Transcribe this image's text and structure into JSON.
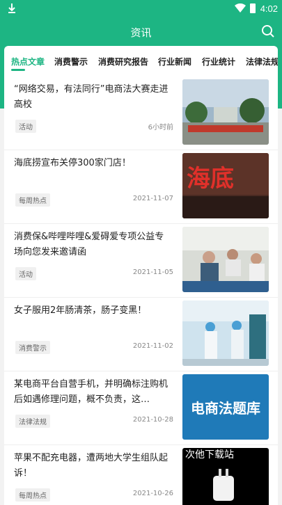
{
  "status_bar": {
    "time": "4:02"
  },
  "header": {
    "title": "资讯"
  },
  "tabs": [
    "热点文章",
    "消费警示",
    "消费研究报告",
    "行业新闻",
    "行业统计",
    "法律法规"
  ],
  "items": [
    {
      "title": "“网络交易，有法同行”电商法大赛走进高校",
      "tag": "活动",
      "time": "6小时前",
      "image": "outdoor-event-photo"
    },
    {
      "title": "海底捞宣布关停300家门店！",
      "tag": "每周热点",
      "time": "2021-11-07",
      "image": "haidilao-sign-photo",
      "image_text": "海底"
    },
    {
      "title": "消费保&哔哩哔哩&爱碍爱专项公益专场向您发来邀请函",
      "tag": "活动",
      "time": "2021-11-05",
      "image": "meeting-photo"
    },
    {
      "title": "女子服用2年肠清茶，肠子变黑！",
      "tag": "消费警示",
      "time": "2021-11-02",
      "image": "hospital-photo"
    },
    {
      "title": "某电商平台自营手机，并明确标注购机后如遇修理问题，概不负责，这…",
      "tag": "法律法规",
      "time": "2021-10-28",
      "image": "ecommerce-law-banner",
      "image_text": "电商法题库"
    },
    {
      "title": "苹果不配充电器，遭两地大学生组队起诉！",
      "tag": "每周热点",
      "time": "2021-10-26",
      "image": "charger-photo",
      "image_text": "次他下载站"
    }
  ]
}
